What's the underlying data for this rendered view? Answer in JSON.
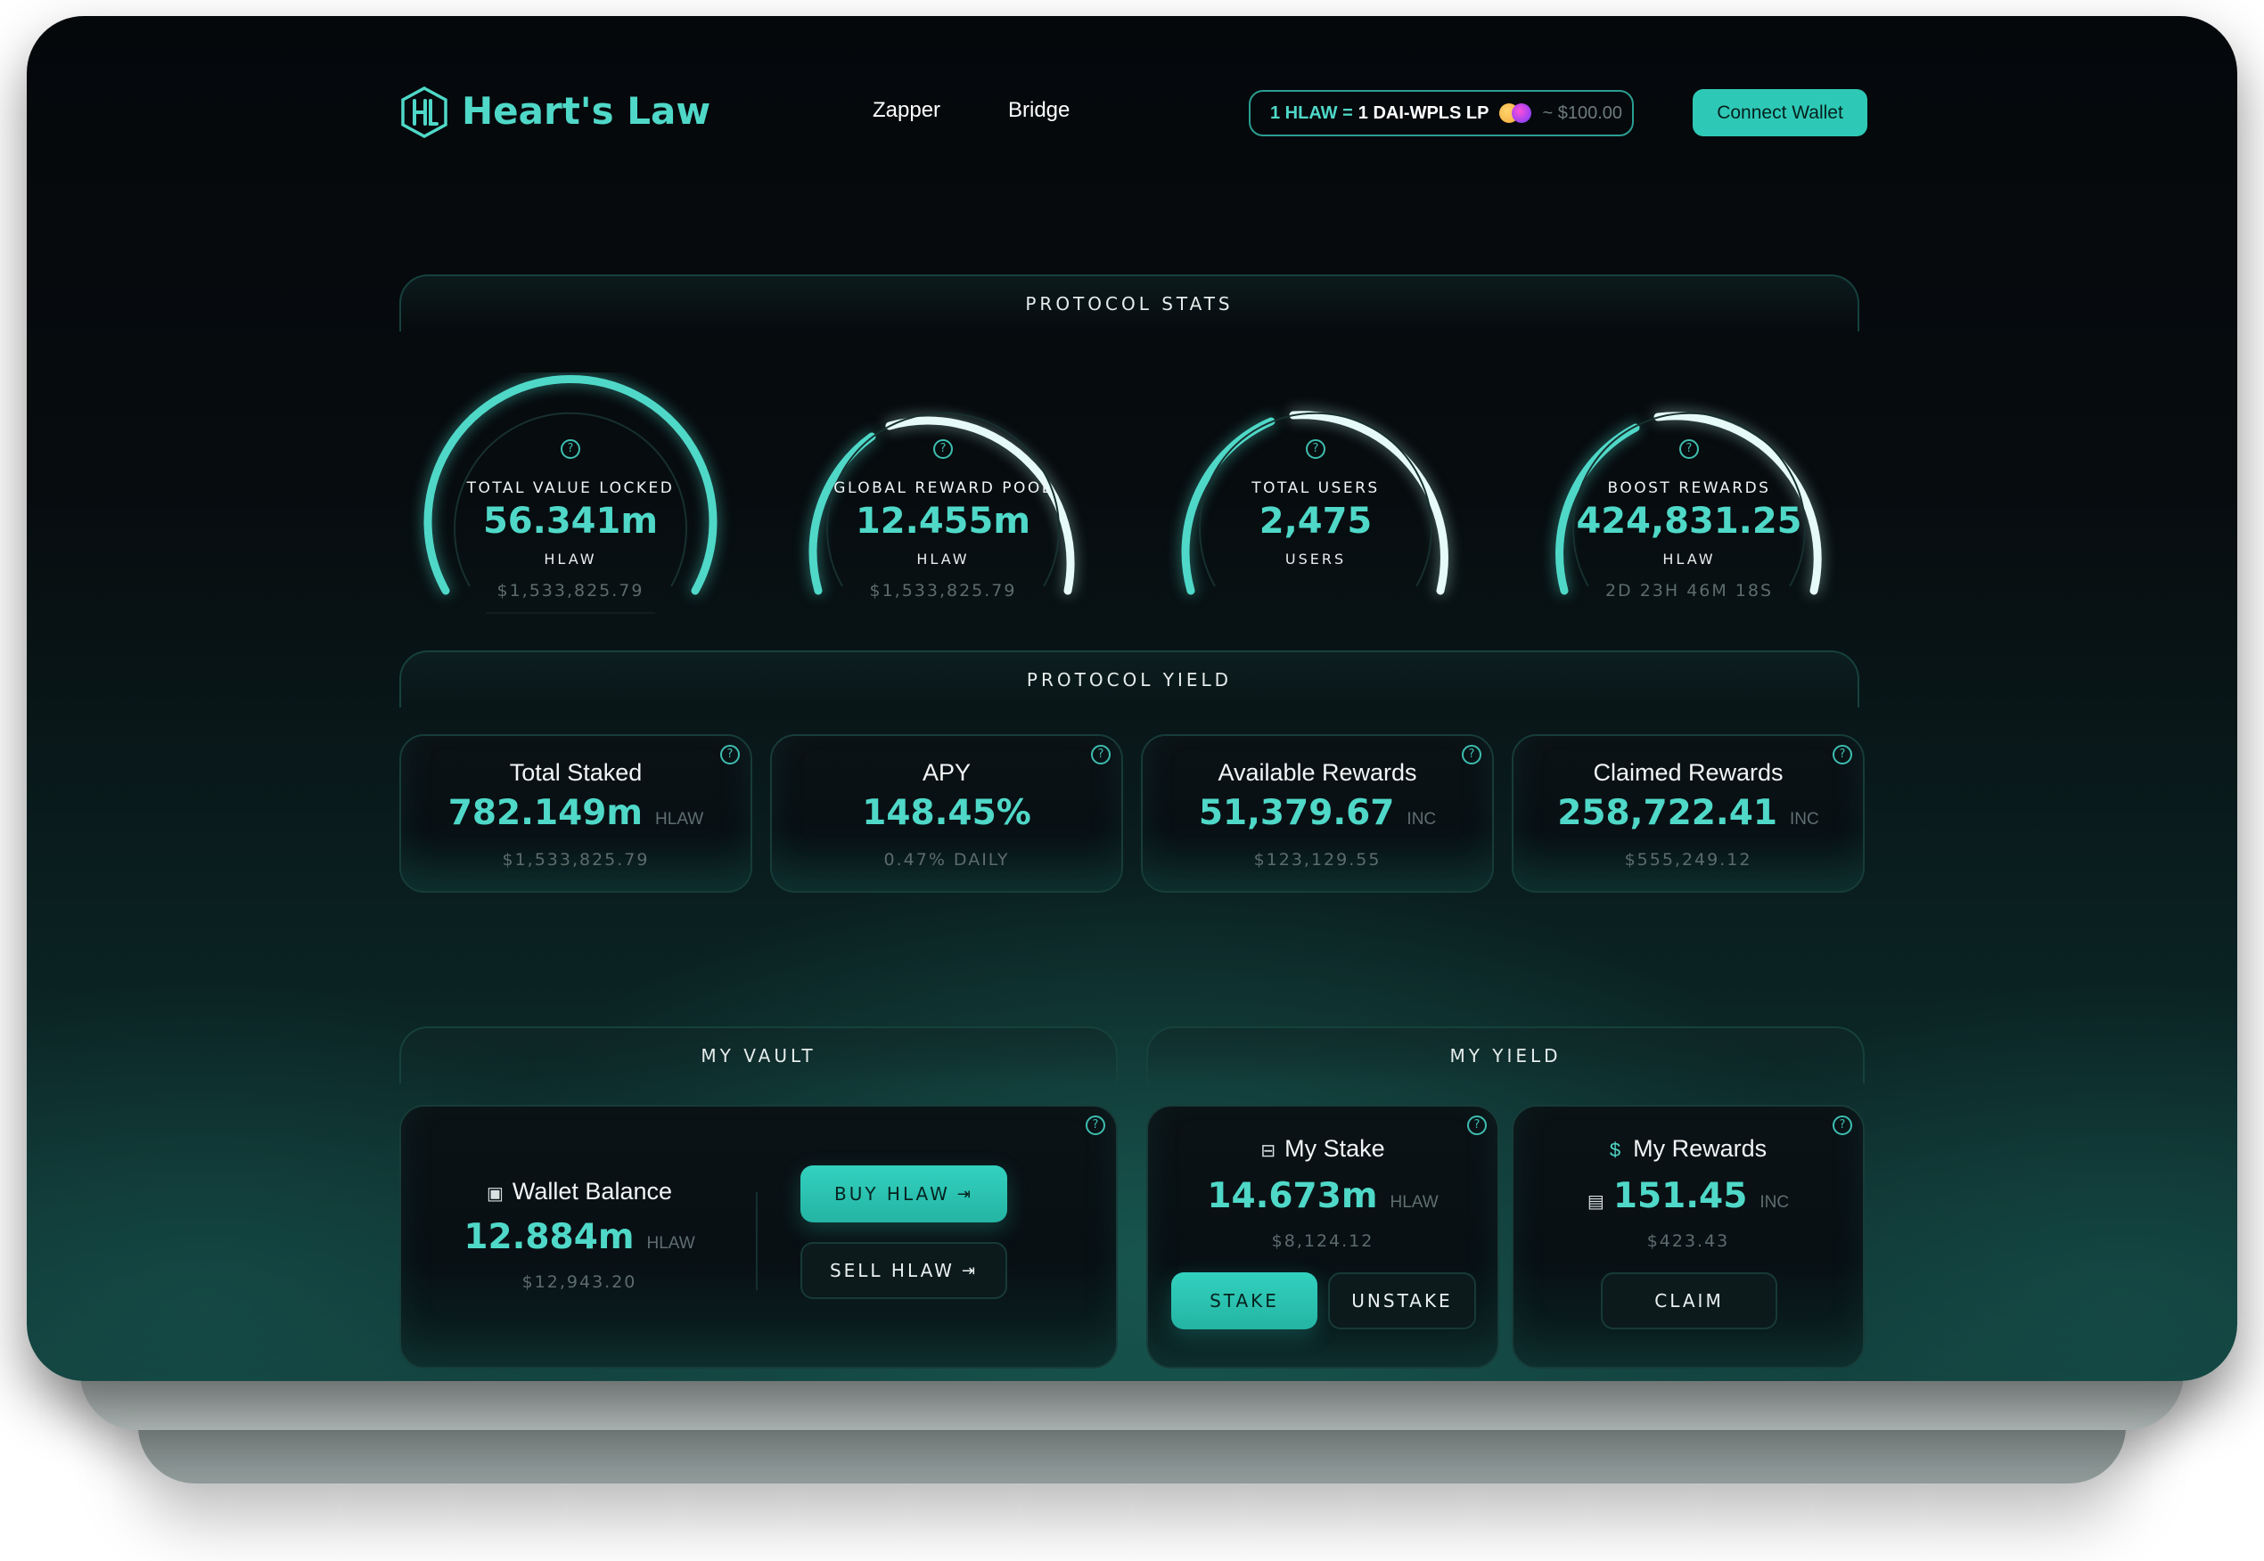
{
  "header": {
    "logo_text": "Heart's Law",
    "nav": [
      "Zapper",
      "Bridge"
    ],
    "price": {
      "lhs": "1 HLAW =",
      "rhs": "1 DAI-WPLS LP",
      "usd": "~ $100.00"
    },
    "connect_label": "Connect Wallet"
  },
  "sections": {
    "stats": "PROTOCOL STATS",
    "yield": "PROTOCOL YIELD",
    "vault": "MY VAULT",
    "my_yield": "MY YIELD"
  },
  "gauges": [
    {
      "label": "TOTAL VALUE LOCKED",
      "value": "56.341m",
      "unit": "HLAW",
      "sub": "$1,533,825.79"
    },
    {
      "label": "GLOBAL REWARD POOL",
      "value": "12.455m",
      "unit": "HLAW",
      "sub": "$1,533,825.79"
    },
    {
      "label": "TOTAL USERS",
      "value": "2,475",
      "unit": "USERS",
      "sub": ""
    },
    {
      "label": "BOOST REWARDS",
      "value": "424,831.25",
      "unit": "HLAW",
      "sub": "2D 23H 46M 18S"
    }
  ],
  "yield_cards": [
    {
      "title": "Total Staked",
      "value": "782.149m",
      "unit": "HLAW",
      "sub": "$1,533,825.79"
    },
    {
      "title": "APY",
      "value": "148.45%",
      "unit": "",
      "sub": "0.47% DAILY"
    },
    {
      "title": "Available Rewards",
      "value": "51,379.67",
      "unit": "INC",
      "sub": "$123,129.55"
    },
    {
      "title": "Claimed Rewards",
      "value": "258,722.41",
      "unit": "INC",
      "sub": "$555,249.12"
    }
  ],
  "vault": {
    "title": "Wallet Balance",
    "value": "12.884m",
    "unit": "HLAW",
    "sub": "$12,943.20",
    "buy_label": "BUY HLAW",
    "sell_label": "SELL HLAW"
  },
  "my_stake": {
    "title": "My Stake",
    "value": "14.673m",
    "unit": "HLAW",
    "sub": "$8,124.12",
    "stake_label": "STAKE",
    "unstake_label": "UNSTAKE"
  },
  "my_rewards": {
    "title": "My Rewards",
    "value": "151.45",
    "unit": "INC",
    "sub": "$423.43",
    "claim_label": "CLAIM"
  },
  "colors": {
    "accent": "#4fd8c8",
    "button": "#2ec9b6",
    "background": "#070c0f"
  }
}
